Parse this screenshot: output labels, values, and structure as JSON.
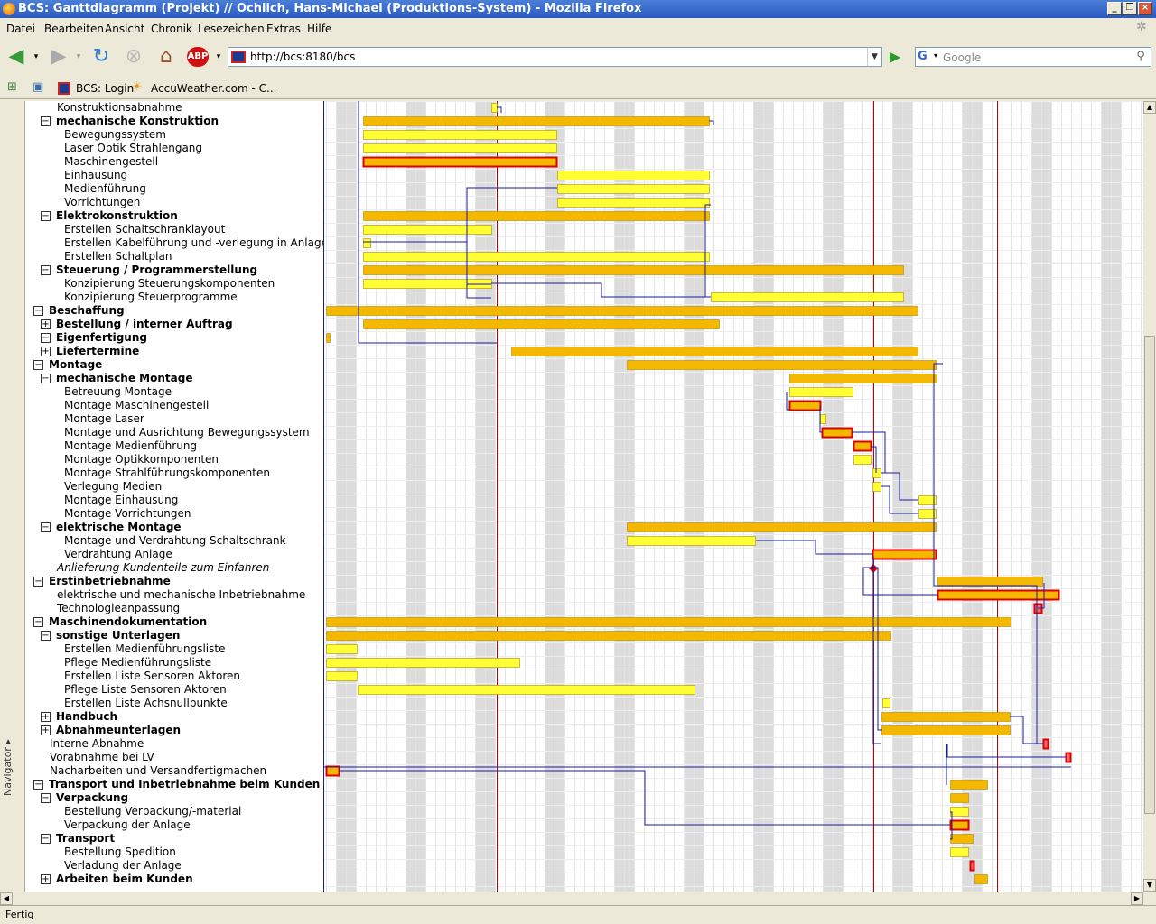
{
  "window": {
    "title": "BCS: Ganttdiagramm (Projekt) // Ochlich, Hans-Michael (Produktions-System) - Mozilla Firefox"
  },
  "menu": [
    "Datei",
    "Bearbeiten",
    "Ansicht",
    "Chronik",
    "Lesezeichen",
    "Extras",
    "Hilfe"
  ],
  "toolbar": {
    "url": "http://bcs:8180/bcs",
    "search_placeholder": "Google"
  },
  "bookmarks": [
    "BCS: Login",
    "AccuWeather.com - C..."
  ],
  "navigator_label": "Navigator",
  "status": "Fertig",
  "colors": {
    "summary_bar": "#f5b800",
    "task_bar": "#ffff33",
    "critical_border": "#dd0000",
    "dependency_line": "#1a1aa0",
    "today_line": "#c00000"
  },
  "gantt": {
    "rows": [
      {
        "label": "Konstruktionsabnahme",
        "indent": 2,
        "style": "normal",
        "toggle": ""
      },
      {
        "label": "mechanische Konstruktion",
        "indent": 1,
        "style": "bold",
        "toggle": "-"
      },
      {
        "label": "Bewegungssystem",
        "indent": 3,
        "style": "normal",
        "toggle": ""
      },
      {
        "label": "Laser Optik Strahlengang",
        "indent": 3,
        "style": "normal",
        "toggle": ""
      },
      {
        "label": "Maschinengestell",
        "indent": 3,
        "style": "normal",
        "toggle": ""
      },
      {
        "label": "Einhausung",
        "indent": 3,
        "style": "normal",
        "toggle": ""
      },
      {
        "label": "Medienführung",
        "indent": 3,
        "style": "normal",
        "toggle": ""
      },
      {
        "label": "Vorrichtungen",
        "indent": 3,
        "style": "normal",
        "toggle": ""
      },
      {
        "label": "Elektrokonstruktion",
        "indent": 1,
        "style": "bold",
        "toggle": "-"
      },
      {
        "label": "Erstellen Schaltschranklayout",
        "indent": 3,
        "style": "normal",
        "toggle": ""
      },
      {
        "label": "Erstellen Kabelführung und -verlegung in Anlage",
        "indent": 3,
        "style": "normal",
        "toggle": ""
      },
      {
        "label": "Erstellen Schaltplan",
        "indent": 3,
        "style": "normal",
        "toggle": ""
      },
      {
        "label": "Steuerung / Programmerstellung",
        "indent": 1,
        "style": "bold",
        "toggle": "-"
      },
      {
        "label": "Konzipierung Steuerungskomponenten",
        "indent": 3,
        "style": "normal",
        "toggle": ""
      },
      {
        "label": "Konzipierung Steuerprogramme",
        "indent": 3,
        "style": "normal",
        "toggle": ""
      },
      {
        "label": "Beschaffung",
        "indent": 0,
        "style": "bold",
        "toggle": "-"
      },
      {
        "label": "Bestellung / interner Auftrag",
        "indent": 1,
        "style": "bold",
        "toggle": "+"
      },
      {
        "label": "Eigenfertigung",
        "indent": 1,
        "style": "bold",
        "toggle": "-"
      },
      {
        "label": "Liefertermine",
        "indent": 1,
        "style": "bold",
        "toggle": "+"
      },
      {
        "label": "Montage",
        "indent": 0,
        "style": "bold",
        "toggle": "-"
      },
      {
        "label": "mechanische Montage",
        "indent": 1,
        "style": "bold",
        "toggle": "-"
      },
      {
        "label": "Betreuung Montage",
        "indent": 3,
        "style": "normal",
        "toggle": ""
      },
      {
        "label": "Montage Maschinengestell",
        "indent": 3,
        "style": "normal",
        "toggle": ""
      },
      {
        "label": "Montage Laser",
        "indent": 3,
        "style": "normal",
        "toggle": ""
      },
      {
        "label": "Montage und Ausrichtung Bewegungssystem",
        "indent": 3,
        "style": "normal",
        "toggle": ""
      },
      {
        "label": "Montage Medienführung",
        "indent": 3,
        "style": "normal",
        "toggle": ""
      },
      {
        "label": "Montage Optikkomponenten",
        "indent": 3,
        "style": "normal",
        "toggle": ""
      },
      {
        "label": "Montage Strahlführungskomponenten",
        "indent": 3,
        "style": "normal",
        "toggle": ""
      },
      {
        "label": "Verlegung Medien",
        "indent": 3,
        "style": "normal",
        "toggle": ""
      },
      {
        "label": "Montage Einhausung",
        "indent": 3,
        "style": "normal",
        "toggle": ""
      },
      {
        "label": "Montage Vorrichtungen",
        "indent": 3,
        "style": "normal",
        "toggle": ""
      },
      {
        "label": "elektrische Montage",
        "indent": 1,
        "style": "bold",
        "toggle": "-"
      },
      {
        "label": "Montage und Verdrahtung Schaltschrank",
        "indent": 3,
        "style": "normal",
        "toggle": ""
      },
      {
        "label": "Verdrahtung Anlage",
        "indent": 3,
        "style": "normal",
        "toggle": ""
      },
      {
        "label": "Anlieferung Kundenteile zum Einfahren",
        "indent": 2,
        "style": "italic",
        "toggle": ""
      },
      {
        "label": "Erstinbetriebnahme",
        "indent": 0,
        "style": "bold",
        "toggle": "-"
      },
      {
        "label": "elektrische und mechanische Inbetriebnahme",
        "indent": 2,
        "style": "normal",
        "toggle": ""
      },
      {
        "label": "Technologieanpassung",
        "indent": 2,
        "style": "normal",
        "toggle": ""
      },
      {
        "label": "Maschinendokumentation",
        "indent": 0,
        "style": "bold",
        "toggle": "-"
      },
      {
        "label": "sonstige Unterlagen",
        "indent": 1,
        "style": "bold",
        "toggle": "-"
      },
      {
        "label": "Erstellen Medienführungsliste",
        "indent": 3,
        "style": "normal",
        "toggle": ""
      },
      {
        "label": "Pflege Medienführungsliste",
        "indent": 3,
        "style": "normal",
        "toggle": ""
      },
      {
        "label": "Erstellen Liste Sensoren Aktoren",
        "indent": 3,
        "style": "normal",
        "toggle": ""
      },
      {
        "label": "Pflege Liste Sensoren Aktoren",
        "indent": 3,
        "style": "normal",
        "toggle": ""
      },
      {
        "label": "Erstellen Liste Achsnullpunkte",
        "indent": 3,
        "style": "normal",
        "toggle": ""
      },
      {
        "label": "Handbuch",
        "indent": 1,
        "style": "bold",
        "toggle": "+"
      },
      {
        "label": "Abnahmeunterlagen",
        "indent": 1,
        "style": "bold",
        "toggle": "+"
      },
      {
        "label": "Interne Abnahme",
        "indent": 0,
        "style": "normal",
        "toggle": ""
      },
      {
        "label": "Vorabnahme bei LV",
        "indent": 0,
        "style": "normal",
        "toggle": ""
      },
      {
        "label": "Nacharbeiten und Versandfertigmachen",
        "indent": 0,
        "style": "normal",
        "toggle": ""
      },
      {
        "label": "Transport und Inbetriebnahme beim Kunden",
        "indent": 0,
        "style": "bold",
        "toggle": "-"
      },
      {
        "label": "Verpackung",
        "indent": 1,
        "style": "bold",
        "toggle": "-"
      },
      {
        "label": "Bestellung Verpackung/-material",
        "indent": 3,
        "style": "normal",
        "toggle": ""
      },
      {
        "label": "Verpackung der Anlage",
        "indent": 3,
        "style": "normal",
        "toggle": ""
      },
      {
        "label": "Transport",
        "indent": 1,
        "style": "bold",
        "toggle": "-"
      },
      {
        "label": "Bestellung Spedition",
        "indent": 3,
        "style": "normal",
        "toggle": ""
      },
      {
        "label": "Verladung der Anlage",
        "indent": 3,
        "style": "normal",
        "toggle": ""
      },
      {
        "label": "Arbeiten beim Kunden",
        "indent": 1,
        "style": "bold",
        "toggle": "+"
      }
    ]
  }
}
